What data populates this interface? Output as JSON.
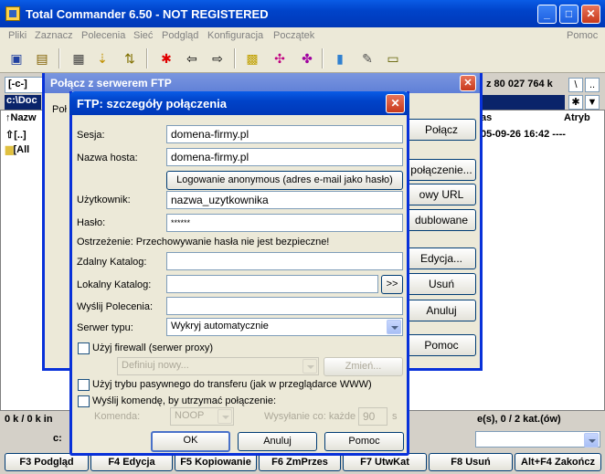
{
  "main_window": {
    "title": "Total Commander 6.50 - NOT REGISTERED",
    "menu": [
      "Pliki",
      "Zaznacz",
      "Polecenia",
      "Sieć",
      "Podgląd",
      "Konfiguracja",
      "Początek"
    ],
    "menu_help": "Pomoc",
    "drive": "[-c-]",
    "drive_info": "z 80 027 764 k",
    "path_left": "c:\\Doc",
    "columns": {
      "name": "↑Nazw",
      "date": "as",
      "attr": "Atryb"
    },
    "rows": [
      {
        "name": "[..]",
        "date": "05-09-26 16:42 ----"
      },
      {
        "name": "[All"
      }
    ],
    "status_left": "0 k / 0 k in",
    "status_right": "e(s), 0 / 2 kat.(ów)",
    "cmd_prefix": "c:",
    "fkeys": [
      "F3 Podgląd",
      "F4 Edycja",
      "F5 Kopiowanie",
      "F6 ZmPrzes",
      "F7 UtwKat",
      "F8 Usuń",
      "Alt+F4 Zakończ"
    ]
  },
  "connect_window": {
    "title": "Połącz z serwerem FTP",
    "label_partial": "Poł",
    "buttons": [
      "Połącz",
      "połączenie...",
      "owy URL",
      "dublowane",
      "Edycja...",
      "Usuń",
      "Anuluj",
      "Pomoc"
    ]
  },
  "dialog": {
    "title": "FTP: szczegóły połączenia",
    "session_label": "Sesja:",
    "session_value": "domena-firmy.pl",
    "host_label": "Nazwa hosta:",
    "host_value": "domena-firmy.pl",
    "anon_button": "Logowanie anonymous (adres e-mail jako hasło)",
    "user_label": "Użytkownik:",
    "user_value": "nazwa_uzytkownika",
    "pass_label": "Hasło:",
    "pass_value": "******",
    "warning": "Ostrzeżenie: Przechowywanie hasła nie jest bezpieczne!",
    "remote_dir_label": "Zdalny Katalog:",
    "remote_dir_value": "",
    "local_dir_label": "Lokalny Katalog:",
    "local_dir_value": "",
    "browse_button": ">>",
    "send_cmd_label": "Wyślij Polecenia:",
    "send_cmd_value": "",
    "server_type_label": "Serwer typu:",
    "server_type_value": "Wykryj automatycznie",
    "firewall_label": "Użyj firewall (serwer proxy)",
    "firewall_select": "Definiuj nowy...",
    "change_button": "Zmień...",
    "passive_label": "Użyj trybu pasywnego do transferu (jak w przeglądarce WWW)",
    "keepalive_label": "Wyślij komendę, by utrzymać połączenie:",
    "command_label": "Komenda:",
    "command_value": "NOOP",
    "interval_label": "Wysyłanie co: każde",
    "interval_value": "90",
    "interval_unit": "s",
    "ok": "OK",
    "cancel": "Anuluj",
    "help": "Pomoc"
  }
}
